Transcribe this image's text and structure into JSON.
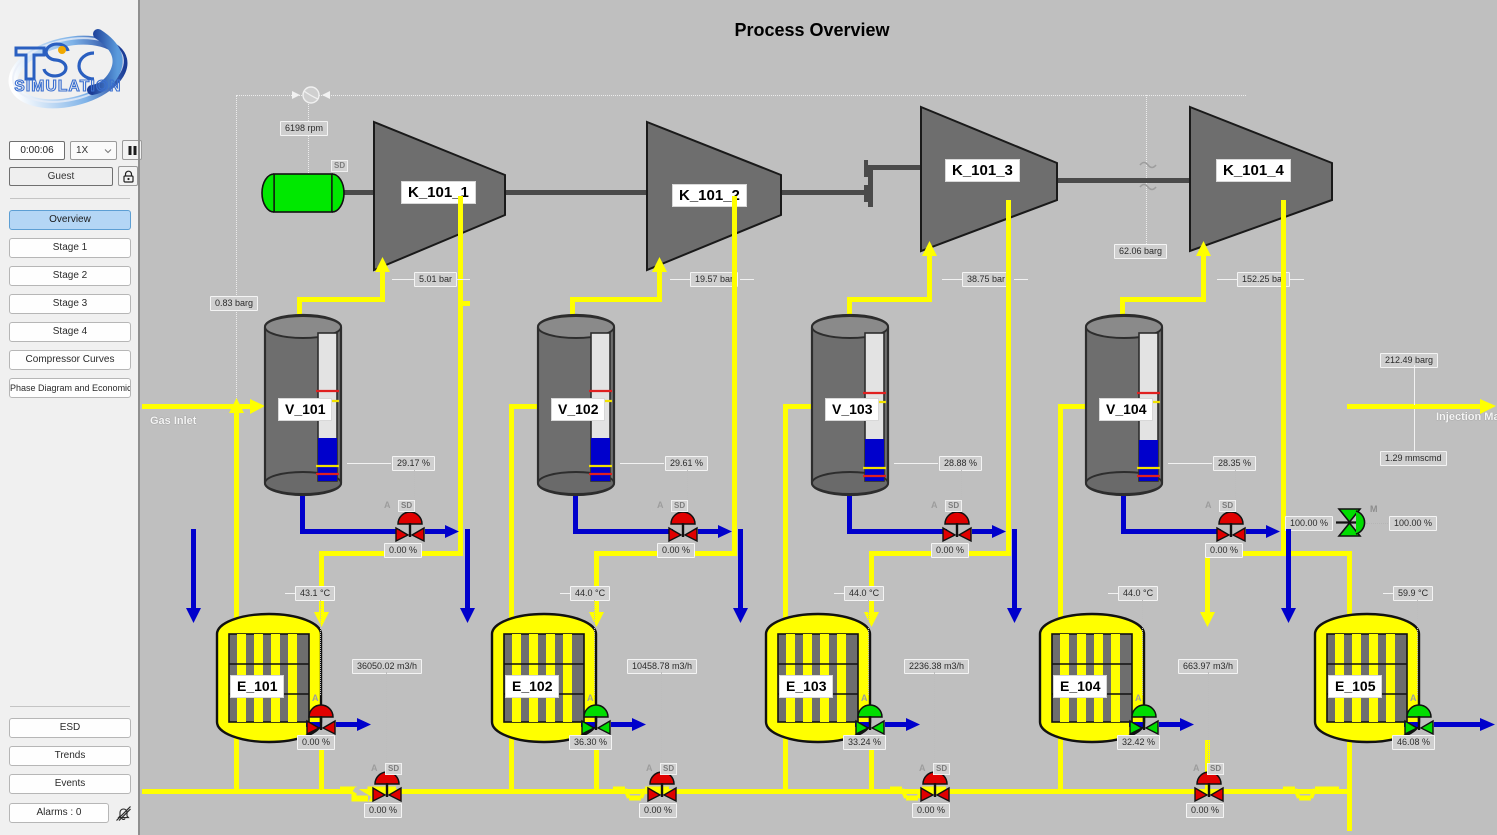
{
  "app": {
    "title": "Process Overview",
    "brand_line1": "TSC",
    "brand_line2": "SIMULATION"
  },
  "sidebar": {
    "clock": "0:00:06",
    "speed": "1X",
    "speed_options": [
      "1X"
    ],
    "pause_icon": "pause-icon",
    "lock_icon": "lock-icon",
    "user": "Guest",
    "nav": [
      {
        "label": "Overview",
        "active": true
      },
      {
        "label": "Stage 1",
        "active": false
      },
      {
        "label": "Stage 2",
        "active": false
      },
      {
        "label": "Stage 3",
        "active": false
      },
      {
        "label": "Stage 4",
        "active": false
      },
      {
        "label": "Compressor Curves",
        "active": false
      },
      {
        "label": "Phase Diagram and Economics",
        "active": false
      }
    ],
    "bottom": [
      {
        "label": "ESD"
      },
      {
        "label": "Trends"
      },
      {
        "label": "Events"
      }
    ],
    "alarms": "Alarms : 0",
    "alarm_mute_icon": "bell-muted-icon"
  },
  "process": {
    "driver": {
      "speed": "6198 rpm",
      "sd_tag": "SD",
      "status_color": "#00e800"
    },
    "compressors": [
      {
        "tag": "K_101_1",
        "discharge_pressure": "5.01 bar"
      },
      {
        "tag": "K_101_2",
        "discharge_pressure": "19.57 bar"
      },
      {
        "tag": "K_101_3",
        "discharge_pressure": "38.75 bar"
      },
      {
        "tag": "K_101_4",
        "discharge_pressure": "152.25 bar"
      }
    ],
    "gas_inlet_label": "Gas Inlet",
    "inlet_pressure": "0.83 barg",
    "interstage_pressure": "62.06 barg",
    "injection_manifold_label": "Injection Manifold",
    "discharge_pressure": "212.49 barg",
    "discharge_flow": "1.29 mmscmd",
    "export_valve": {
      "tag": "M",
      "position_left": "100.00 %",
      "position_right": "100.00 %",
      "color": "#00dd00"
    },
    "separators": [
      {
        "tag": "V_101",
        "level": "29.17 %",
        "level_pct": 29.17,
        "drain_valve": {
          "a_tag": "A",
          "sd_tag": "SD",
          "position": "0.00 %",
          "color": "#e00000"
        }
      },
      {
        "tag": "V_102",
        "level": "29.61 %",
        "level_pct": 29.61,
        "drain_valve": {
          "a_tag": "A",
          "sd_tag": "SD",
          "position": "0.00 %",
          "color": "#e00000"
        }
      },
      {
        "tag": "V_103",
        "level": "28.88 %",
        "level_pct": 28.88,
        "drain_valve": {
          "a_tag": "A",
          "sd_tag": "SD",
          "position": "0.00 %",
          "color": "#e00000"
        }
      },
      {
        "tag": "V_104",
        "level": "28.35 %",
        "level_pct": 28.35,
        "drain_valve": {
          "a_tag": "A",
          "sd_tag": "SD",
          "position": "0.00 %",
          "color": "#e00000"
        }
      }
    ],
    "coolers": [
      {
        "tag": "E_101",
        "temperature": "43.1 °C",
        "valve": {
          "a_tag": "A",
          "position": "0.00 %",
          "color": "#e00000"
        },
        "recycle": {
          "flow": "36050.02 m3/h",
          "a_tag": "A",
          "sd_tag": "SD",
          "position": "0.00 %",
          "color": "#e00000"
        }
      },
      {
        "tag": "E_102",
        "temperature": "44.0 °C",
        "valve": {
          "a_tag": "A",
          "position": "36.30 %",
          "color": "#00dd00"
        },
        "recycle": {
          "flow": "10458.78 m3/h",
          "a_tag": "A",
          "sd_tag": "SD",
          "position": "0.00 %",
          "color": "#e00000"
        }
      },
      {
        "tag": "E_103",
        "temperature": "44.0 °C",
        "valve": {
          "a_tag": "A",
          "position": "33.24 %",
          "color": "#00dd00"
        },
        "recycle": {
          "flow": "2236.38 m3/h",
          "a_tag": "A",
          "sd_tag": "SD",
          "position": "0.00 %",
          "color": "#e00000"
        }
      },
      {
        "tag": "E_104",
        "temperature": "44.0 °C",
        "valve": {
          "a_tag": "A",
          "position": "32.42 %",
          "color": "#00dd00"
        },
        "recycle": {
          "flow": "663.97 m3/h",
          "a_tag": "A",
          "sd_tag": "SD",
          "position": "0.00 %",
          "color": "#e00000"
        }
      },
      {
        "tag": "E_105",
        "temperature": "59.9 °C",
        "valve": {
          "a_tag": "A",
          "position": "46.08 %",
          "color": "#00dd00"
        },
        "recycle": null
      }
    ]
  },
  "colors": {
    "background": "#bfbfbf",
    "gas_pipe": "#ffff00",
    "liquid_pipe": "#0000cc",
    "shaft": "#4a4a4a",
    "equipment": "#6e6e6e",
    "accent_blue": "#b4d6f5"
  }
}
